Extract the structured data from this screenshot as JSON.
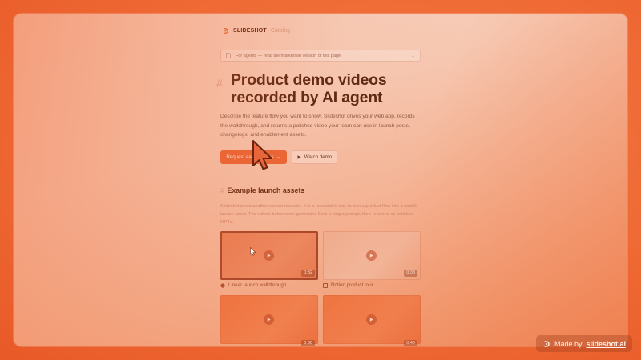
{
  "brand": {
    "name": "SLIDESHOT",
    "tag": "Catalog"
  },
  "notice": {
    "text": "For agents — read the markdown version of this page",
    "arrow": "→"
  },
  "hero": {
    "hash": "#",
    "title": "Product demo videos recorded by AI agent",
    "description": "Describe the feature flow you want to show. Slideshot drives your web app, records the walkthrough, and returns a polished video your team can use in launch posts, changelogs, and enablement assets."
  },
  "buttons": {
    "primary_label": "Request early access",
    "primary_arrow": "→",
    "secondary_label": "Watch demo"
  },
  "examples": {
    "hash": "#",
    "title": "Example launch assets",
    "description": "Slideshot is not another screen recorder. It is a repeatable way to turn a product flow into a usable launch asset. The videos below were generated from a single prompt, then returned as polished MP4s.",
    "cards": [
      {
        "label": "Linear launch walkthrough",
        "duration": "0:32"
      },
      {
        "label": "Notion product tour",
        "duration": "0:38"
      },
      {
        "label": "",
        "duration": "0:30"
      },
      {
        "label": "",
        "duration": "0:40"
      }
    ]
  },
  "watermark": {
    "prefix": "Made by",
    "link": "slideshot.ai"
  },
  "icons": {
    "app": "slideshot-logo-icon",
    "cursor": "mouse-pointer-icon",
    "play": "play-icon",
    "document": "document-icon"
  },
  "colors": {
    "accent": "#ea6533",
    "background": "#ef6a35",
    "heading": "#5a2712"
  }
}
